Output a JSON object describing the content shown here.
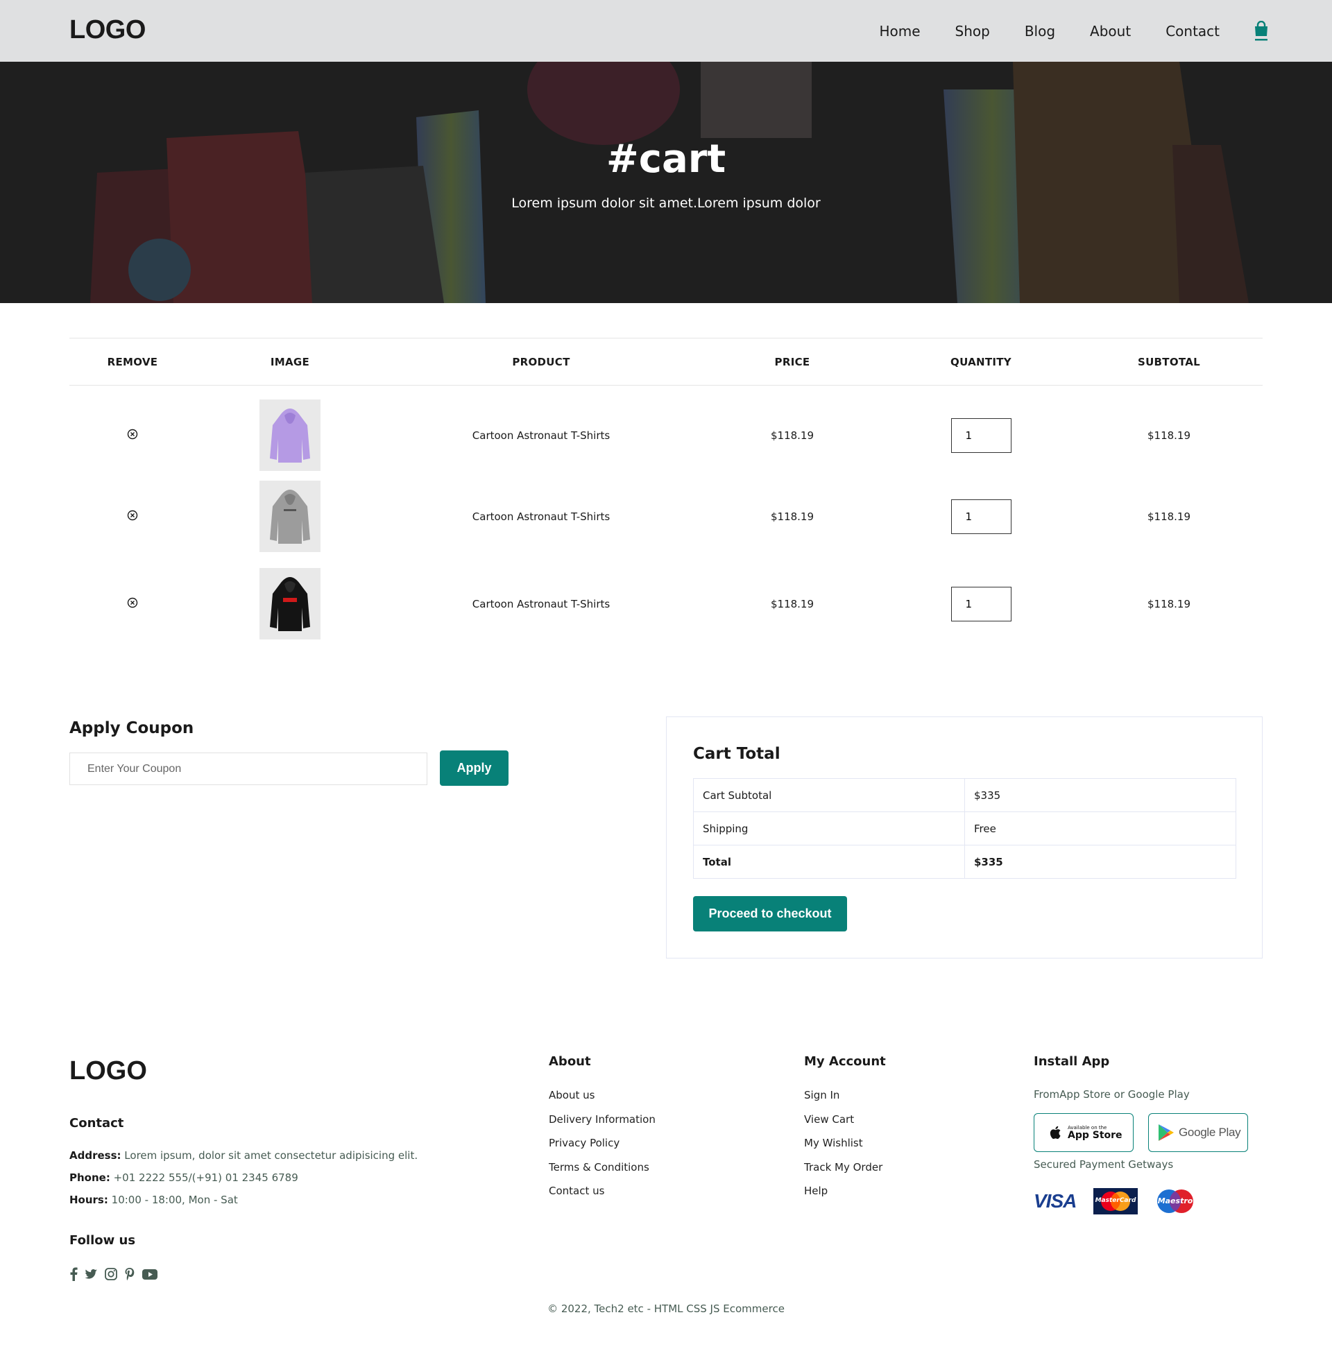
{
  "header": {
    "logo": "LOGO",
    "nav": [
      "Home",
      "Shop",
      "Blog",
      "About",
      "Contact"
    ]
  },
  "hero": {
    "title": "#cart",
    "subtitle": "Lorem ipsum dolor sit amet.Lorem ipsum dolor"
  },
  "cart": {
    "columns": [
      "REMOVE",
      "IMAGE",
      "PRODUCT",
      "PRICE",
      "QUANTITY",
      "SUBTOTAL"
    ],
    "rows": [
      {
        "product": "Cartoon Astronaut T-Shirts",
        "price": "$118.19",
        "quantity": "1",
        "subtotal": "$118.19",
        "image_icon": "purple-hoodie-image"
      },
      {
        "product": "Cartoon Astronaut T-Shirts",
        "price": "$118.19",
        "quantity": "1",
        "subtotal": "$118.19",
        "image_icon": "grey-hoodie-image"
      },
      {
        "product": "Cartoon Astronaut T-Shirts",
        "price": "$118.19",
        "quantity": "1",
        "subtotal": "$118.19",
        "image_icon": "black-hoodie-image"
      }
    ]
  },
  "coupon": {
    "title": "Apply Coupon",
    "placeholder": "Enter Your Coupon",
    "button": "Apply"
  },
  "cart_total": {
    "title": "Cart Total",
    "rows": [
      {
        "label": "Cart Subtotal",
        "value": "$335"
      },
      {
        "label": "Shipping",
        "value": "Free"
      },
      {
        "label": "Total",
        "value": "$335"
      }
    ],
    "button": "Proceed to checkout"
  },
  "footer": {
    "logo": "LOGO",
    "contact_heading": "Contact",
    "address_label": "Address:",
    "address": "Lorem ipsum, dolor sit amet consectetur adipisicing elit.",
    "phone_label": "Phone:",
    "phone": "+01 2222 555/(+91) 01 2345 6789",
    "hours_label": "Hours:",
    "hours": "10:00 - 18:00, Mon - Sat",
    "follow_heading": "Follow us",
    "social_icons": [
      "facebook-icon",
      "twitter-icon",
      "instagram-icon",
      "pinterest-icon",
      "youtube-icon"
    ],
    "about_heading": "About",
    "about_links": [
      "About us",
      "Delivery Information",
      "Privacy Policy",
      "Terms & Conditions",
      "Contact us"
    ],
    "account_heading": "My Account",
    "account_links": [
      "Sign In",
      "View Cart",
      "My Wishlist",
      "Track My Order",
      "Help"
    ],
    "app_heading": "Install App",
    "app_text": "FromApp Store or Google Play",
    "app_store_small": "Available on the",
    "app_store": "App Store",
    "google_play": "Google Play",
    "payment_text": "Secured Payment Getways",
    "payment_visa": "VISA",
    "payment_mastercard": "MasterCard",
    "payment_maestro": "Maestro",
    "copyright": "© 2022, Tech2 etc - HTML CSS JS Ecommerce"
  },
  "colors": {
    "accent": "#088178",
    "header_bg": "#dfe0e1",
    "hero_bg": "#1f1f1f"
  }
}
